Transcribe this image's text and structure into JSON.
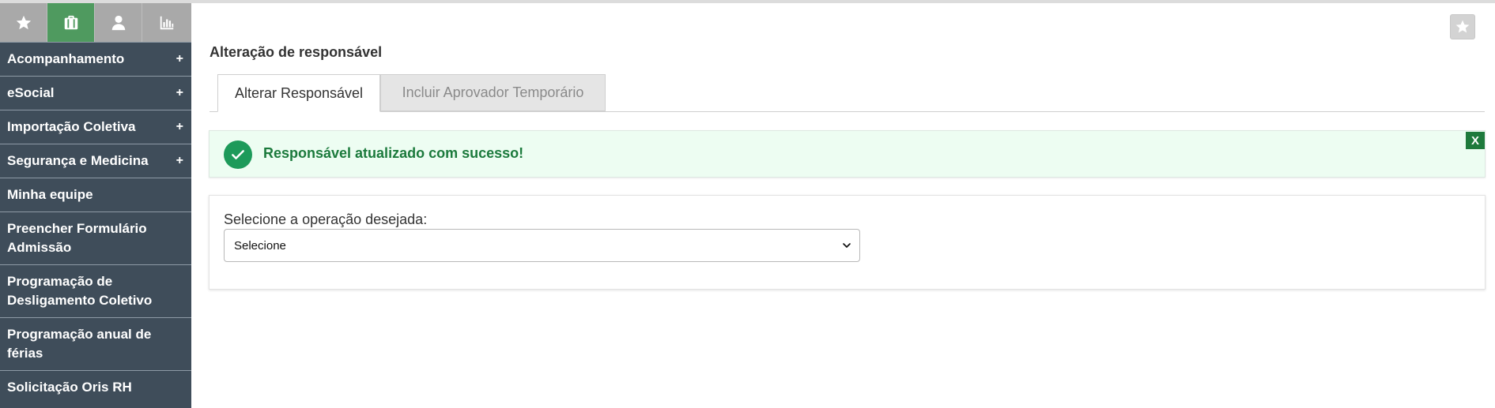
{
  "sidebar": {
    "iconbar": [
      {
        "icon": "star-icon",
        "active": false
      },
      {
        "icon": "briefcase-icon",
        "active": true
      },
      {
        "icon": "user-icon",
        "active": false
      },
      {
        "icon": "bar-chart-icon",
        "active": false
      }
    ],
    "items": [
      {
        "label": "Acompanhamento",
        "expand": "+"
      },
      {
        "label": "eSocial",
        "expand": "+"
      },
      {
        "label": "Importação Coletiva",
        "expand": "+"
      },
      {
        "label": "Segurança e Medicina",
        "expand": "+"
      },
      {
        "label": "Minha equipe"
      },
      {
        "label": "Preencher Formulário Admissão"
      },
      {
        "label": "Programação de Desligamento Coletivo"
      },
      {
        "label": "Programação anual de férias"
      },
      {
        "label": "Solicitação Oris RH"
      }
    ]
  },
  "header": {
    "title": "Alteração de responsável"
  },
  "tabs": [
    {
      "label": "Alterar Responsável",
      "active": true
    },
    {
      "label": "Incluir Aprovador Temporário",
      "active": false
    }
  ],
  "alert": {
    "message": "Responsável atualizado com sucesso!",
    "close_label": "X",
    "color": "#1d9a5a"
  },
  "form": {
    "label": "Selecione a operação desejada:",
    "select_value": "Selecione"
  },
  "colors": {
    "sidebar_bg": "#3f4d5a",
    "active_icon_bg": "#4f9a5f",
    "success": "#1b7a3c"
  }
}
